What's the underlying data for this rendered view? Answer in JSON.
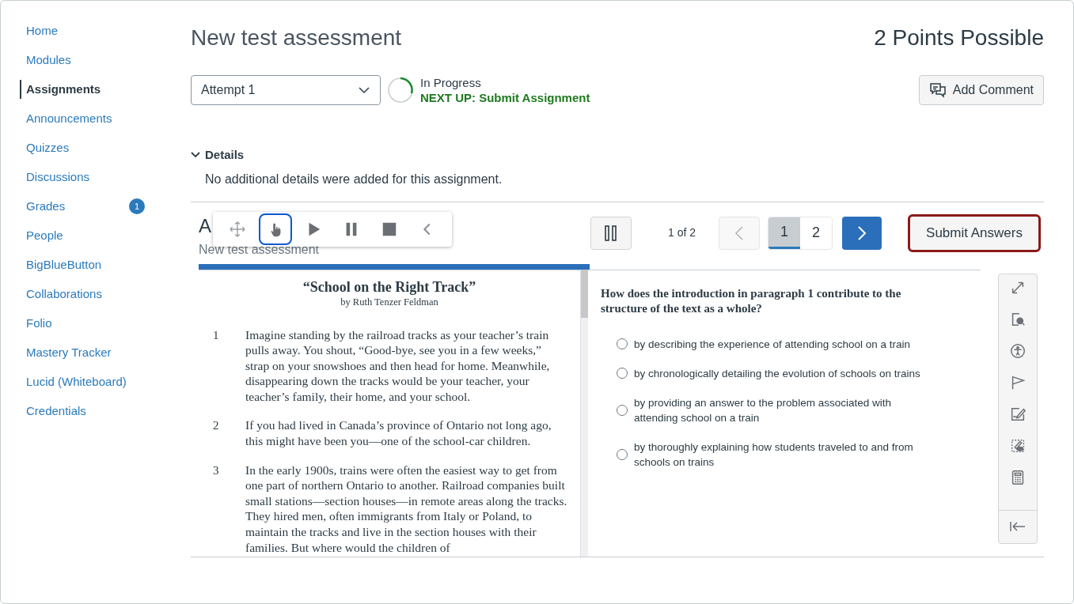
{
  "sidebar": {
    "items": [
      {
        "label": "Home",
        "selected": false
      },
      {
        "label": "Modules",
        "selected": false
      },
      {
        "label": "Assignments",
        "selected": true
      },
      {
        "label": "Announcements",
        "selected": false
      },
      {
        "label": "Quizzes",
        "selected": false
      },
      {
        "label": "Discussions",
        "selected": false
      },
      {
        "label": "Grades",
        "selected": false,
        "badge": "1"
      },
      {
        "label": "People",
        "selected": false
      },
      {
        "label": "BigBlueButton",
        "selected": false
      },
      {
        "label": "Collaborations",
        "selected": false
      },
      {
        "label": "Folio",
        "selected": false
      },
      {
        "label": "Mastery Tracker",
        "selected": false
      },
      {
        "label": "Lucid (Whiteboard)",
        "selected": false
      },
      {
        "label": "Credentials",
        "selected": false
      }
    ]
  },
  "header": {
    "title": "New test assessment",
    "points": "2 Points Possible"
  },
  "attempt": {
    "value": "Attempt 1",
    "status": "In Progress",
    "next_up": "NEXT UP: Submit Assignment",
    "comment_button": "Add Comment"
  },
  "details": {
    "label": "Details",
    "expanded": true,
    "text": "No additional details were added for this assignment."
  },
  "quiz": {
    "heading": "A",
    "subtitle": "New test assessment",
    "toolbar": [
      {
        "kind": "move",
        "selected": false
      },
      {
        "kind": "point",
        "selected": true
      },
      {
        "kind": "play",
        "selected": false
      },
      {
        "kind": "pause",
        "selected": false
      },
      {
        "kind": "stop",
        "selected": false
      },
      {
        "kind": "collapse",
        "selected": false
      }
    ],
    "page_count": "1 of 2",
    "pages": [
      {
        "label": "1",
        "selected": true
      },
      {
        "label": "2",
        "selected": false
      }
    ],
    "submit": "Submit Answers",
    "progress": {
      "level": 0.5
    },
    "passage": {
      "title": "“School on the Right Track”",
      "author": "by Ruth Tenzer Feldman",
      "paragraphs": [
        {
          "number": "1",
          "text": "Imagine standing by the railroad tracks as your teacher’s train pulls away. You shout, “Good-bye, see you in a few weeks,” strap on your snowshoes and then head for home. Meanwhile, disappearing down the tracks would be your teacher, your teacher’s family, their home, and your school."
        },
        {
          "number": "2",
          "text": "If you had lived in Canada’s province of Ontario not long ago, this might have been you—one of the school-car children."
        },
        {
          "number": "3",
          "text": "In the early 1900s, trains were often the easiest way to get from one part of northern Ontario to another. Railroad companies built small stations—section houses—in remote areas along the tracks. They hired men, often immigrants from Italy or Poland, to maintain the tracks and live in the section houses with their families. But where would the children of"
        }
      ]
    },
    "question": "How does the introduction in paragraph 1 contribute to the structure of the text as a whole?",
    "options": [
      {
        "text": "by describing the experience of attending school on a train",
        "selected": false
      },
      {
        "text": "by chronologically detailing the evolution of schools on trains",
        "selected": false
      },
      {
        "text": "by providing an answer to the problem associated with attending school on a train",
        "selected": false
      },
      {
        "text": "by thoroughly explaining how students traveled to and from schools on trains",
        "selected": false
      }
    ],
    "tools": [
      {
        "kind": "expand"
      },
      {
        "kind": "magnifier"
      },
      {
        "kind": "accessibility"
      },
      {
        "kind": "flag"
      },
      {
        "kind": "notepad"
      },
      {
        "kind": "highlighter"
      },
      {
        "kind": "calculator"
      }
    ]
  }
}
